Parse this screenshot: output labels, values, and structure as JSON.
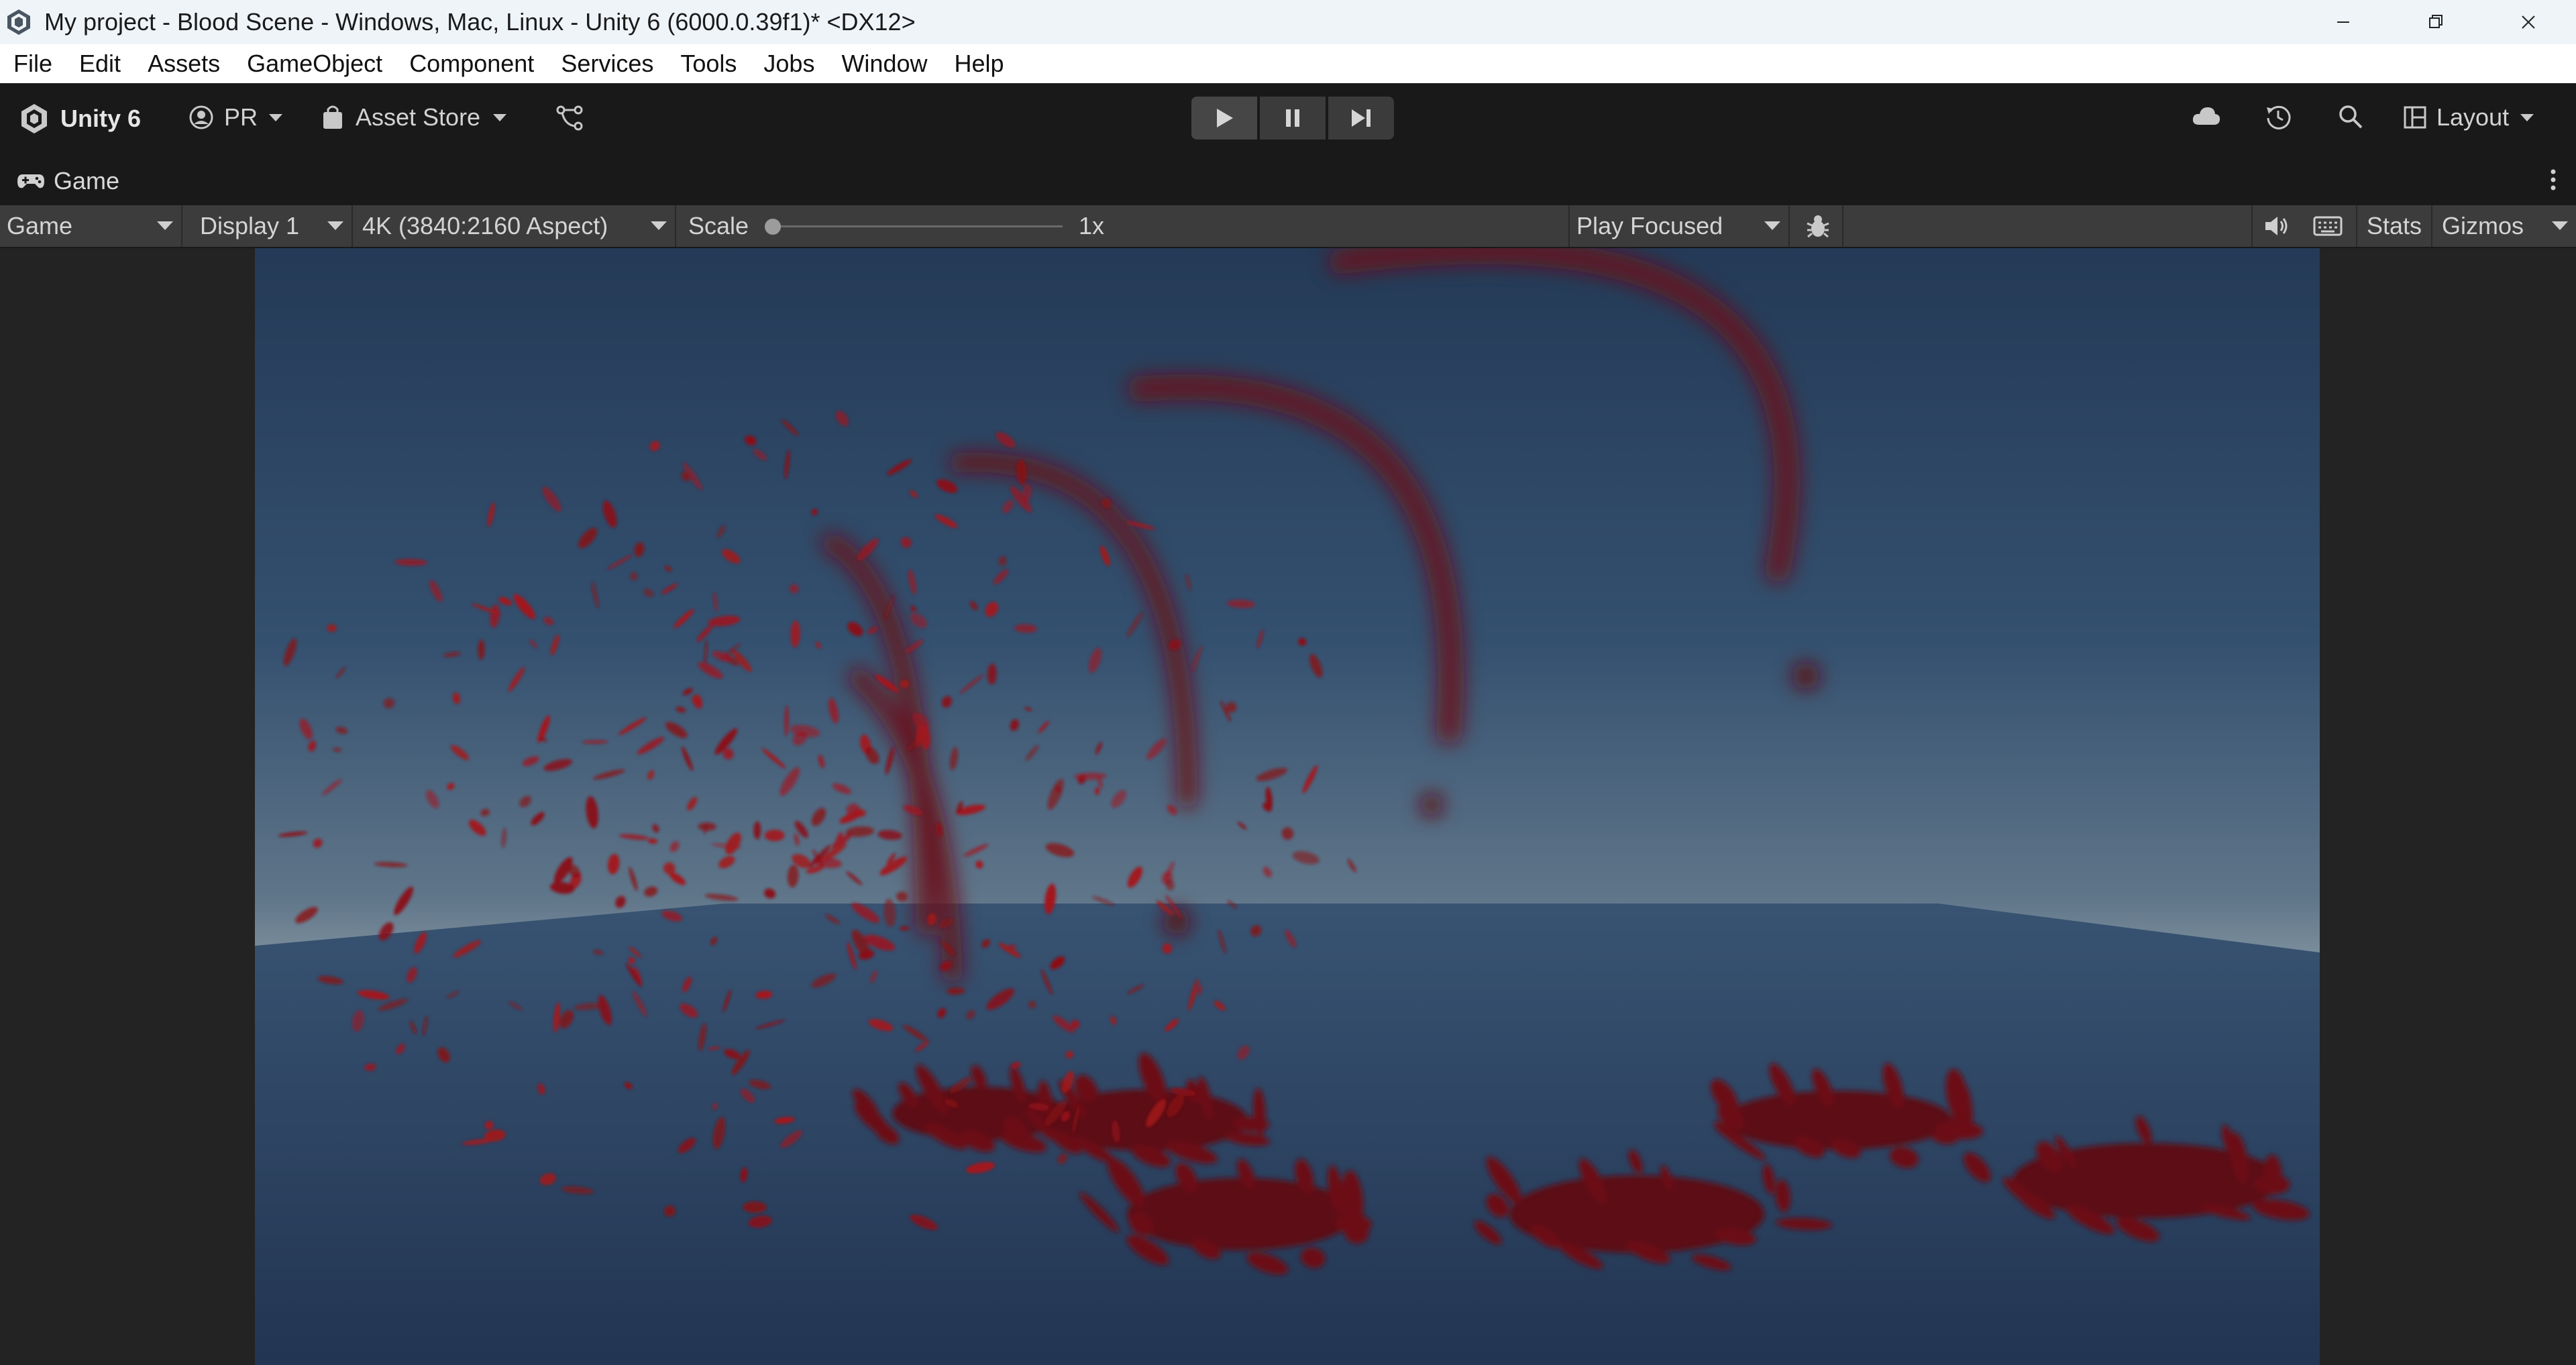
{
  "window": {
    "title": "My project - Blood Scene - Windows, Mac, Linux - Unity 6 (6000.0.39f1)* <DX12>",
    "app_icon": "unity-logo-icon",
    "controls": [
      "minimize-icon",
      "restore-icon",
      "close-icon"
    ]
  },
  "menu": {
    "items": [
      "File",
      "Edit",
      "Assets",
      "GameObject",
      "Component",
      "Services",
      "Tools",
      "Jobs",
      "Window",
      "Help"
    ]
  },
  "toolbar": {
    "brand": "Unity 6",
    "account": "PR",
    "asset_store": "Asset Store",
    "play_controls": [
      "play-icon",
      "pause-icon",
      "step-icon"
    ],
    "right_icons": [
      "cloud-icon",
      "history-icon",
      "search-icon"
    ],
    "layout": "Layout"
  },
  "game_tab": {
    "label": "Game",
    "icon": "gamepad-icon"
  },
  "game_toolbar": {
    "view_mode": "Game",
    "display": "Display 1",
    "resolution": "4K (3840:2160 Aspect)",
    "scale_label": "Scale",
    "scale_value": "1x",
    "scale_level": 0,
    "play_mode": "Play Focused",
    "stats": "Stats",
    "gizmos": "Gizmos"
  },
  "colors": {
    "title_bar": "#eff4f9",
    "toolbar": "#191919",
    "game_toolbar": "#3c3c3c",
    "blood": "#8a0f14",
    "sky_top": "#243a57",
    "horizon": "#8c9aa3",
    "ground": "#2c3f58"
  }
}
